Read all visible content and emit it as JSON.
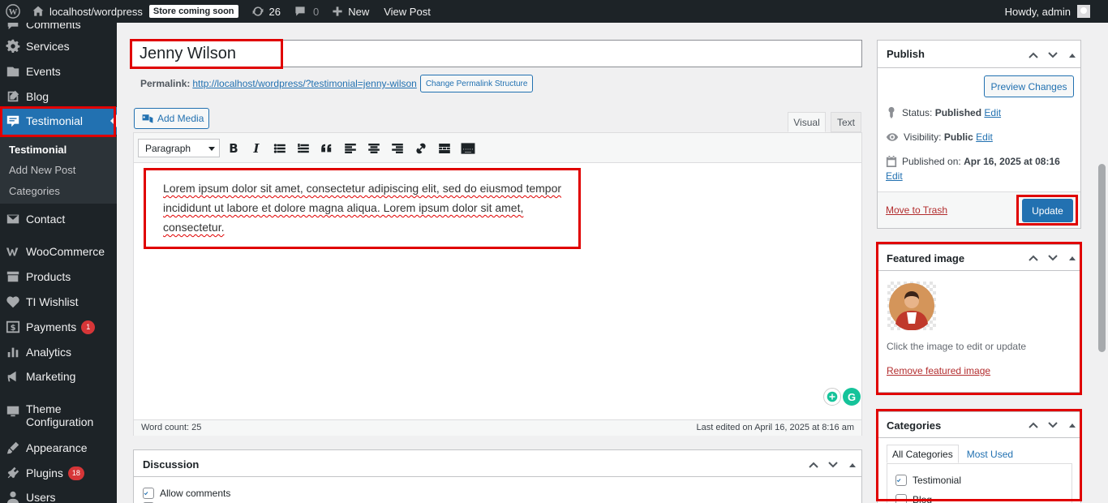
{
  "adminbar": {
    "site_name": "localhost/wordpress",
    "store_badge": "Store coming soon",
    "updates_count": "26",
    "comments_count": "0",
    "new_label": "New",
    "view_post": "View Post",
    "howdy": "Howdy, admin"
  },
  "sidebar": {
    "items": [
      {
        "label": "Comments"
      },
      {
        "label": "Services"
      },
      {
        "label": "Events"
      },
      {
        "label": "Blog"
      },
      {
        "label": "Testimonial"
      },
      {
        "label": "Contact"
      },
      {
        "label": "WooCommerce"
      },
      {
        "label": "Products"
      },
      {
        "label": "TI Wishlist"
      },
      {
        "label": "Payments",
        "badge": "1"
      },
      {
        "label": "Analytics"
      },
      {
        "label": "Marketing"
      },
      {
        "label": "Theme Configuration"
      },
      {
        "label": "Appearance"
      },
      {
        "label": "Plugins",
        "badge": "18"
      },
      {
        "label": "Users"
      }
    ],
    "submenu": [
      "Testimonial",
      "Add New Post",
      "Categories"
    ]
  },
  "editor": {
    "title": "Jenny Wilson",
    "permalink_label": "Permalink:",
    "permalink_url": "http://localhost/wordpress/?testimonial=jenny-wilson",
    "change_permalink": "Change Permalink Structure",
    "add_media": "Add Media",
    "tab_visual": "Visual",
    "tab_text": "Text",
    "format": "Paragraph",
    "body": "Lorem ipsum dolor sit amet, consectetur adipiscing elit, sed do eiusmod tempor incididunt ut labore et dolore magna aliqua. Lorem ipsum dolor sit amet, consectetur.",
    "word_count": "Word count: 25",
    "last_edited": "Last edited on April 16, 2025 at 8:16 am"
  },
  "discussion": {
    "title": "Discussion",
    "allow_comments": "Allow comments"
  },
  "publish": {
    "title": "Publish",
    "preview": "Preview Changes",
    "status_label": "Status:",
    "status_value": "Published",
    "visibility_label": "Visibility:",
    "visibility_value": "Public",
    "published_label": "Published on:",
    "published_value": "Apr 16, 2025 at 08:16",
    "edit": "Edit",
    "trash": "Move to Trash",
    "update": "Update"
  },
  "featured": {
    "title": "Featured image",
    "hint": "Click the image to edit or update",
    "remove": "Remove featured image"
  },
  "categories": {
    "title": "Categories",
    "tab_all": "All Categories",
    "tab_most": "Most Used",
    "items": [
      {
        "label": "Testimonial",
        "checked": true
      },
      {
        "label": "Blog",
        "checked": false
      }
    ]
  },
  "colors": {
    "accent": "#2271b1",
    "admin_dark": "#1d2327",
    "highlight": "#e00000"
  }
}
